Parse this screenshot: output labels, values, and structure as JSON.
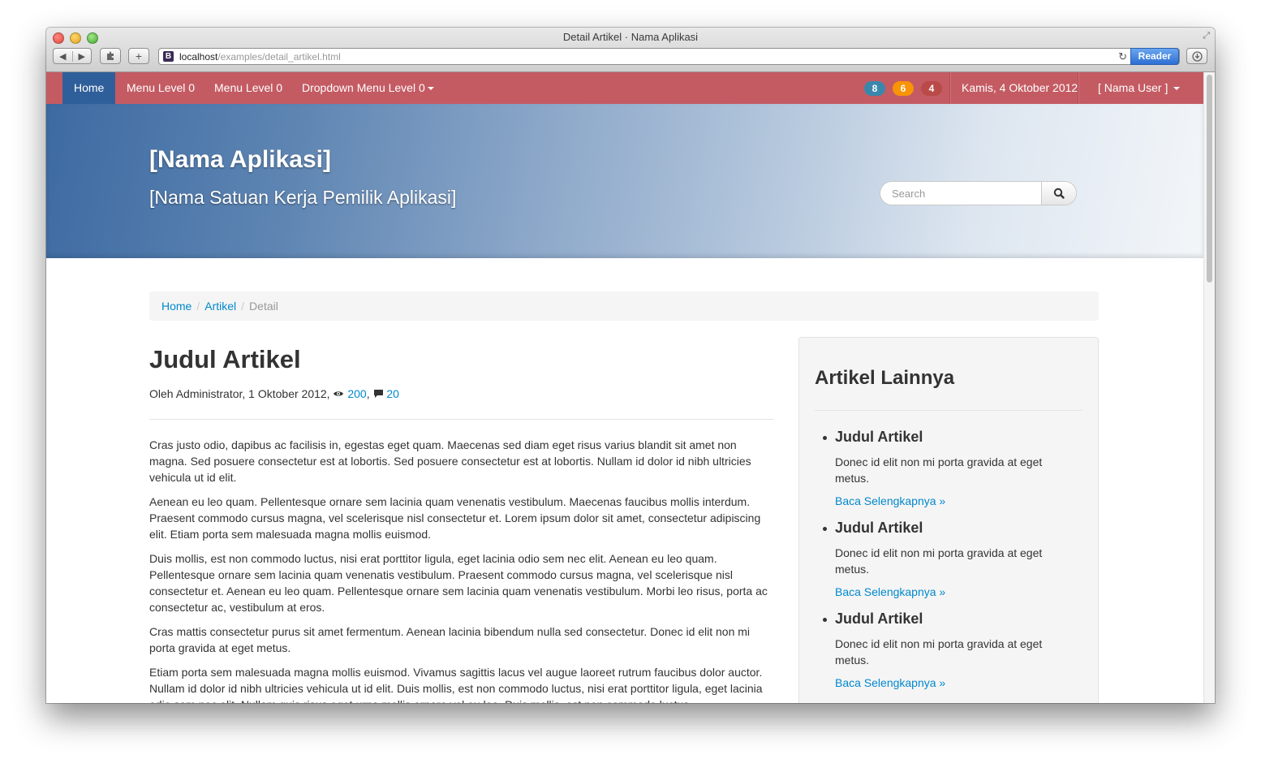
{
  "window": {
    "title": "Detail Artikel · Nama Aplikasi",
    "url_host": "localhost",
    "url_path": "/examples/detail_artikel.html",
    "reader_label": "Reader",
    "favicon_letter": "B"
  },
  "navbar": {
    "home": "Home",
    "menu1": "Menu Level 0",
    "menu2": "Menu Level 0",
    "dropdown": "Dropdown Menu Level 0",
    "badges": [
      "8",
      "6",
      "4"
    ],
    "date": "Kamis, 4 Oktober 2012",
    "user": "[ Nama User ]",
    "colors": {
      "bar": "#c45b63",
      "active": "#2f5f9a",
      "badge_blue": "#3a87ad",
      "badge_orange": "#f89406",
      "badge_red": "#b94a48"
    }
  },
  "header": {
    "app_name": "[Nama Aplikasi]",
    "unit_name": "[Nama Satuan Kerja Pemilik Aplikasi]",
    "search_placeholder": "Search"
  },
  "breadcrumb": {
    "items": [
      "Home",
      "Artikel"
    ],
    "separator": "/",
    "active": "Detail"
  },
  "article": {
    "title": "Judul Artikel",
    "meta_prefix": "Oleh Administrator, 1 Oktober 2012, ",
    "views": "200",
    "comments": "20",
    "paragraphs": [
      "Cras justo odio, dapibus ac facilisis in, egestas eget quam. Maecenas sed diam eget risus varius blandit sit amet non magna. Sed posuere consectetur est at lobortis. Sed posuere consectetur est at lobortis. Nullam id dolor id nibh ultricies vehicula ut id elit.",
      "Aenean eu leo quam. Pellentesque ornare sem lacinia quam venenatis vestibulum. Maecenas faucibus mollis interdum. Praesent commodo cursus magna, vel scelerisque nisl consectetur et. Lorem ipsum dolor sit amet, consectetur adipiscing elit. Etiam porta sem malesuada magna mollis euismod.",
      "Duis mollis, est non commodo luctus, nisi erat porttitor ligula, eget lacinia odio sem nec elit. Aenean eu leo quam. Pellentesque ornare sem lacinia quam venenatis vestibulum. Praesent commodo cursus magna, vel scelerisque nisl consectetur et. Aenean eu leo quam. Pellentesque ornare sem lacinia quam venenatis vestibulum. Morbi leo risus, porta ac consectetur ac, vestibulum at eros.",
      "Cras mattis consectetur purus sit amet fermentum. Aenean lacinia bibendum nulla sed consectetur. Donec id elit non mi porta gravida at eget metus.",
      "Etiam porta sem malesuada magna mollis euismod. Vivamus sagittis lacus vel augue laoreet rutrum faucibus dolor auctor. Nullam id dolor id nibh ultricies vehicula ut id elit. Duis mollis, est non commodo luctus, nisi erat porttitor ligula, eget lacinia odio sem nec elit. Nullam quis risus eget urna mollis ornare vel eu leo. Duis mollis, est non commodo luctus."
    ]
  },
  "sidebar": {
    "title": "Artikel Lainnya",
    "items": [
      {
        "title": "Judul Artikel",
        "text": "Donec id elit non mi porta gravida at eget metus.",
        "link": "Baca Selengkapnya »"
      },
      {
        "title": "Judul Artikel",
        "text": "Donec id elit non mi porta gravida at eget metus.",
        "link": "Baca Selengkapnya »"
      },
      {
        "title": "Judul Artikel",
        "text": "Donec id elit non mi porta gravida at eget metus.",
        "link": "Baca Selengkapnya »"
      }
    ]
  },
  "icons": {
    "views": "eye-icon",
    "comments": "comment-icon",
    "search": "search-icon",
    "reload": "reload-icon"
  }
}
